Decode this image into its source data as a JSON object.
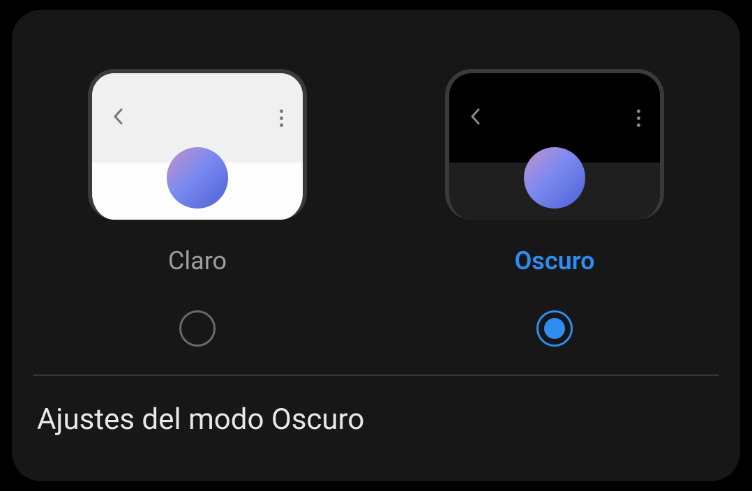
{
  "theme": {
    "options": [
      {
        "label": "Claro",
        "selected": false
      },
      {
        "label": "Oscuro",
        "selected": true
      }
    ]
  },
  "settings": {
    "dark_mode_settings_label": "Ajustes del modo Oscuro"
  },
  "colors": {
    "accent": "#2f8cf0",
    "muted": "#9e9e9e",
    "panel": "#171717"
  }
}
